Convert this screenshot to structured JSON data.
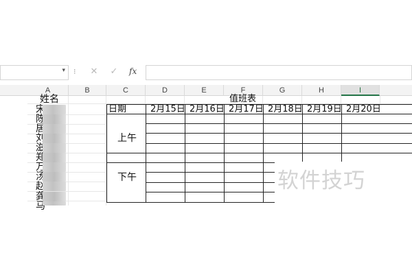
{
  "formula_bar": {
    "name_box_value": "",
    "dropdown_glyph": "▾",
    "separator_glyph": "⁝",
    "cancel_glyph": "✕",
    "enter_glyph": "✓",
    "fx_label": "fx",
    "formula_value": ""
  },
  "columns": [
    "A",
    "B",
    "C",
    "D",
    "E",
    "F",
    "G",
    "H",
    "I"
  ],
  "active_column": "I",
  "sheet": {
    "name_header": "姓名",
    "names": [
      "宋",
      "陈",
      "居",
      "刘",
      "滋",
      "郑",
      "万",
      "汤",
      "赵",
      "龚",
      "马"
    ],
    "duty_title": "值班表",
    "date_header": "日期",
    "dates": [
      "2月15日",
      "2月16日",
      "2月17日",
      "2月18日",
      "2月19日",
      "2月20日"
    ],
    "morning_label": "上午",
    "afternoon_label": "下午"
  },
  "watermark": "软件技巧",
  "colors": {
    "grid": "#e6e6e6",
    "border": "#222222",
    "active_column": "#217346",
    "watermark": "#d3d3d3"
  }
}
